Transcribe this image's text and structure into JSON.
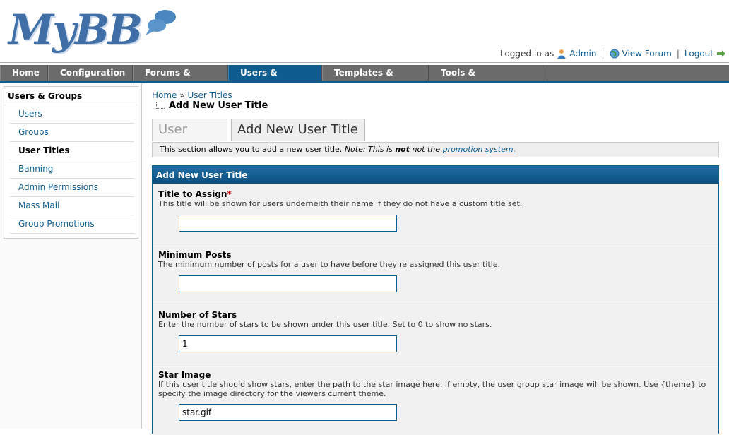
{
  "header": {
    "logo_text": "MyBB",
    "logged_in_as": "Logged in as",
    "user": "Admin",
    "view_forum": "View Forum",
    "logout": "Logout"
  },
  "nav": {
    "items": [
      {
        "label": "Home"
      },
      {
        "label": "Configuration"
      },
      {
        "label": "Forums & Posts"
      },
      {
        "label": "Users & Groups"
      },
      {
        "label": "Templates & Style"
      },
      {
        "label": "Tools & Maintenance"
      }
    ],
    "active": "Users & Groups"
  },
  "sidebar": {
    "title": "Users & Groups",
    "items": [
      {
        "label": "Users"
      },
      {
        "label": "Groups"
      },
      {
        "label": "User Titles"
      },
      {
        "label": "Banning"
      },
      {
        "label": "Admin Permissions"
      },
      {
        "label": "Mass Mail"
      },
      {
        "label": "Group Promotions"
      }
    ],
    "active": "User Titles"
  },
  "breadcrumb": {
    "home": "Home",
    "sep": "»",
    "section": "User Titles",
    "current": "Add New User Title"
  },
  "tabs": [
    {
      "label": "User Titles"
    },
    {
      "label": "Add New User Title"
    }
  ],
  "description": {
    "text": "This section allows you to add a new user title.",
    "note_prefix": "Note: This is",
    "not": "not",
    "not2": "not the",
    "link": "promotion system."
  },
  "form": {
    "title": "Add New User Title",
    "fields": [
      {
        "label": "Title to Assign",
        "required": "*",
        "hint": "This title will be shown for users underneith their name if they do not have a custom title set.",
        "value": ""
      },
      {
        "label": "Minimum Posts",
        "hint": "The minimum number of posts for a user to have before they're assigned this user title.",
        "value": ""
      },
      {
        "label": "Number of Stars",
        "hint": "Enter the number of stars to be shown under this user title. Set to 0 to show no stars.",
        "value": "1"
      },
      {
        "label": "Star Image",
        "hint": "If this user title should show stars, enter the path to the star image here. If empty, the user group star image will be shown. Use {theme} to specify the image directory for the viewers current theme.",
        "value": "star.gif"
      }
    ]
  },
  "colors": {
    "accent": "#0f5c8e",
    "nav_bg": "#6b6b6b",
    "required": "#cc0000"
  }
}
